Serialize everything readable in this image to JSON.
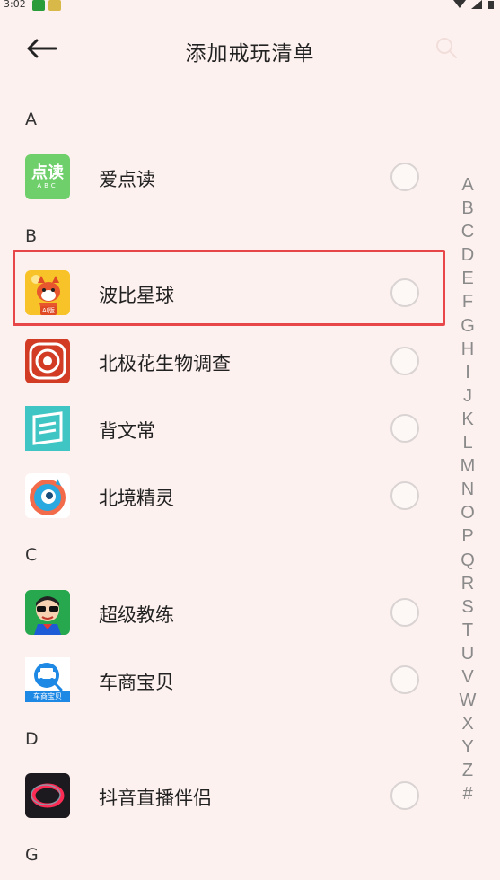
{
  "status_bar": {
    "time": "3:02"
  },
  "header": {
    "title": "添加戒玩清单"
  },
  "sections": [
    {
      "letter": "A",
      "apps": [
        {
          "name": "爱点读",
          "icon": "aidiandu-icon",
          "icon_text": "点读",
          "icon_subtext": "ABC"
        }
      ]
    },
    {
      "letter": "B",
      "apps": [
        {
          "name": "波比星球",
          "icon": "bobi-planet-icon",
          "icon_text": "AI版"
        },
        {
          "name": "北极花生物调查",
          "icon": "beijihua-icon"
        },
        {
          "name": "背文常",
          "icon": "beiwenchang-icon"
        },
        {
          "name": "北境精灵",
          "icon": "beijing-jingling-icon"
        }
      ]
    },
    {
      "letter": "C",
      "apps": [
        {
          "name": "超级教练",
          "icon": "chaoji-jiaolian-icon"
        },
        {
          "name": "车商宝贝",
          "icon": "cheshang-baobei-icon",
          "icon_text": "车商宝贝"
        }
      ]
    },
    {
      "letter": "D",
      "apps": [
        {
          "name": "抖音直播伴侣",
          "icon": "douyin-zhibo-icon"
        }
      ]
    },
    {
      "letter": "G",
      "apps": []
    }
  ],
  "index_letters": [
    "A",
    "B",
    "C",
    "D",
    "E",
    "F",
    "G",
    "H",
    "I",
    "J",
    "K",
    "L",
    "M",
    "N",
    "O",
    "P",
    "Q",
    "R",
    "S",
    "T",
    "U",
    "V",
    "W",
    "X",
    "Y",
    "Z",
    "#"
  ],
  "colors": {
    "background": "#fdf1ef",
    "highlight": "#e8474a",
    "index_text": "#8a8a8a"
  }
}
